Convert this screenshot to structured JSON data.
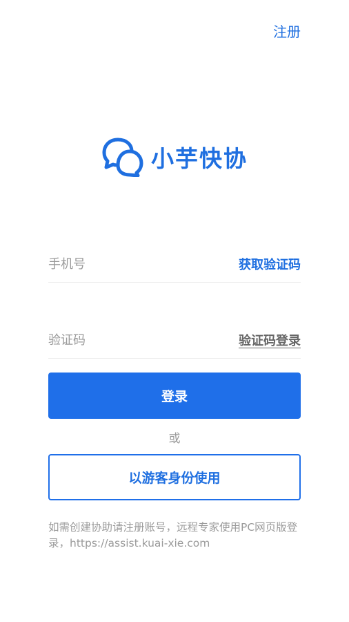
{
  "header": {
    "register_label": "注册"
  },
  "brand": {
    "name": "小芋快协",
    "color": "#1f6fe0"
  },
  "form": {
    "phone_placeholder": "手机号",
    "get_code_label": "获取验证码",
    "code_placeholder": "验证码",
    "code_login_label": "验证码登录",
    "login_label": "登录",
    "or_label": "或",
    "guest_label": "以游客身份使用"
  },
  "footer": {
    "hint": "如需创建协助请注册账号，远程专家使用PC网页版登录，https://assist.kuai-xie.com"
  }
}
